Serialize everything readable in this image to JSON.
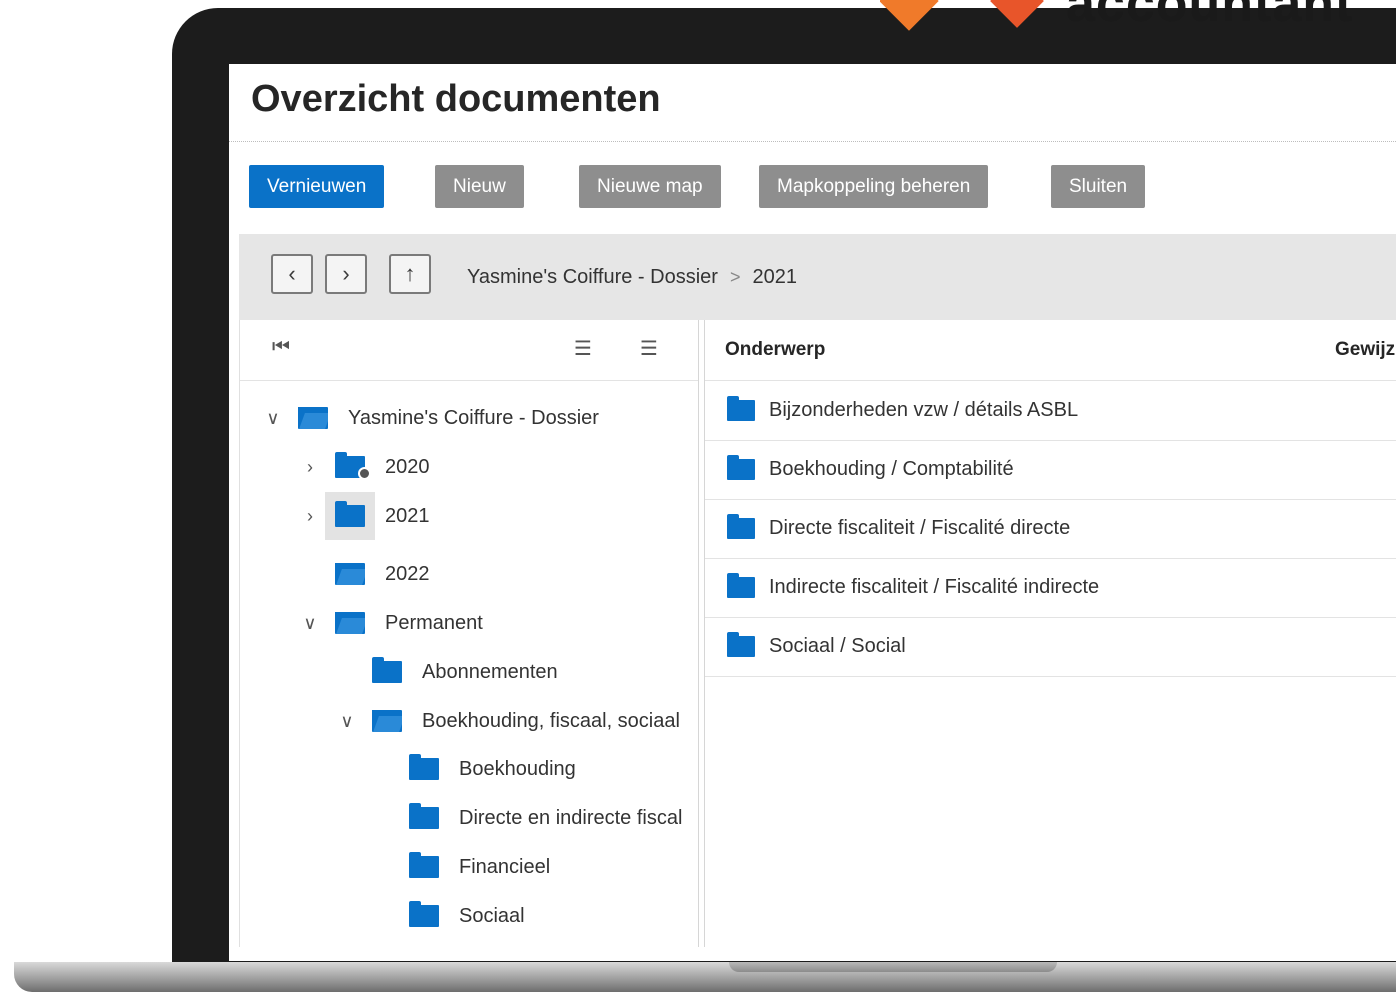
{
  "brand": {
    "word": "accountant"
  },
  "page": {
    "title": "Overzicht documenten"
  },
  "toolbar": {
    "refresh_label": "Vernieuwen",
    "new_label": "Nieuw",
    "new_folder_label": "Nieuwe map",
    "manage_link_label": "Mapkoppeling beheren",
    "close_label": "Sluiten"
  },
  "nav": {
    "back_icon": "chevron-left-icon",
    "forward_icon": "chevron-right-icon",
    "up_icon": "arrow-up-icon",
    "breadcrumb": [
      "Yasmine's Coiffure - Dossier",
      "2021"
    ]
  },
  "tree": {
    "items": [
      {
        "label": "Yasmine's Coiffure - Dossier",
        "level": 0,
        "expander": "expanded",
        "folder": "open"
      },
      {
        "label": "2020",
        "level": 1,
        "expander": "collapsed",
        "folder": "shared"
      },
      {
        "label": "2021",
        "level": 1,
        "expander": "collapsed",
        "folder": "closed",
        "selected": true
      },
      {
        "label": "2022",
        "level": 1,
        "expander": "none",
        "folder": "open"
      },
      {
        "label": "Permanent",
        "level": 1,
        "expander": "expanded",
        "folder": "open"
      },
      {
        "label": "Abonnementen",
        "level": 2,
        "expander": "none",
        "folder": "closed"
      },
      {
        "label": "Boekhouding, fiscaal, sociaal",
        "level": 2,
        "expander": "expanded",
        "folder": "open"
      },
      {
        "label": "Boekhouding",
        "level": 3,
        "expander": "none",
        "folder": "closed"
      },
      {
        "label": "Directe en indirecte fiscal",
        "level": 3,
        "expander": "none",
        "folder": "closed"
      },
      {
        "label": "Financieel",
        "level": 3,
        "expander": "none",
        "folder": "closed"
      },
      {
        "label": "Sociaal",
        "level": 3,
        "expander": "none",
        "folder": "closed"
      }
    ]
  },
  "list": {
    "columns": [
      "Onderwerp",
      "Gewijz"
    ],
    "rows": [
      "Bijzonderheden vzw / détails ASBL",
      "Boekhouding / Comptabilité",
      "Directe fiscaliteit / Fiscalité directe",
      "Indirecte fiscaliteit / Fiscalité indirecte",
      "Sociaal / Social"
    ]
  },
  "colors": {
    "accent": "#0a72c8",
    "secondary_button": "#8e8e8e",
    "nav_bar": "#e6e6e6"
  }
}
